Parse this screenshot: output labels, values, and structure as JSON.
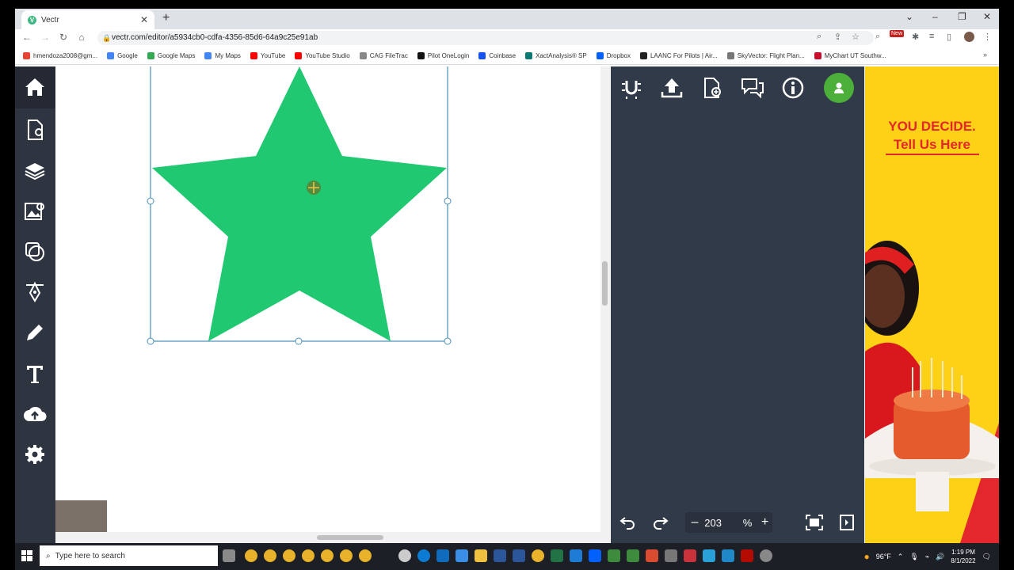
{
  "browser": {
    "tab_title": "Vectr",
    "tab_favicon_letter": "V",
    "url": "vectr.com/editor/a5934cb0-cdfa-4356-85d6-64a9c25e91ab",
    "new_badge": "New"
  },
  "bookmarks": [
    {
      "label": "hmendoza2008@gm...",
      "color": "#ea4335"
    },
    {
      "label": "Google",
      "color": "#4285f4"
    },
    {
      "label": "Google Maps",
      "color": "#34a853"
    },
    {
      "label": "My Maps",
      "color": "#4285f4"
    },
    {
      "label": "YouTube",
      "color": "#ff0000"
    },
    {
      "label": "YouTube Studio",
      "color": "#ff0000"
    },
    {
      "label": "CAG FileTrac",
      "color": "#888888"
    },
    {
      "label": "Pilot OneLogin",
      "color": "#111111"
    },
    {
      "label": "Coinbase",
      "color": "#1652f0"
    },
    {
      "label": "XactAnalysis® SP",
      "color": "#0b7a75"
    },
    {
      "label": "Dropbox",
      "color": "#0061ff"
    },
    {
      "label": "LAANC For Pilots | Air...",
      "color": "#222222"
    },
    {
      "label": "SkyVector: Flight Plan...",
      "color": "#777777"
    },
    {
      "label": "MyChart UT Southw...",
      "color": "#c8102e"
    }
  ],
  "editor": {
    "shape": "star",
    "shape_fill": "#21c872",
    "selection_color": "#4a90b8"
  },
  "zoom": {
    "value": "203",
    "unit": "%",
    "minus": "–",
    "plus": "+"
  },
  "ad": {
    "line1": "YOU DECIDE.",
    "line2": "Tell Us Here"
  },
  "taskbar": {
    "search_placeholder": "Type here to search",
    "temperature": "96°F",
    "time": "1:19 PM",
    "date": "8/1/2022"
  },
  "colors": {
    "left_toolbar": "#2e3440",
    "right_panel": "#313a48",
    "avatar": "#4caf3a",
    "ad_background": "#fcd116",
    "ad_text": "#e4262d"
  }
}
